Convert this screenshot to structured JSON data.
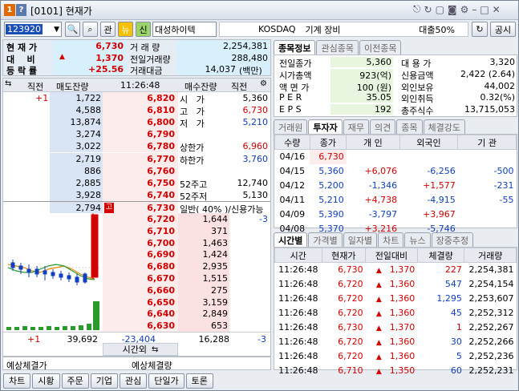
{
  "window": {
    "screen_no": "1",
    "screen_mark": "?",
    "title": "[0101] 현재가",
    "controls": [
      "pin",
      "refresh",
      "capture",
      "camera",
      "settings",
      "minimize",
      "maximize",
      "close"
    ]
  },
  "toolbar": {
    "code": "123920",
    "btn_related": "관",
    "btn_fav": "뉴",
    "btn_credit": "신",
    "name": "대성하이텍",
    "market": "KOSDAQ",
    "sector": "기계 장비",
    "margin": "대출50%",
    "btn_notice": "공시"
  },
  "summary": {
    "rows": [
      {
        "label": "현 재 가",
        "value": "6,730",
        "label2": "거 래 량",
        "value2": "2,254,381"
      },
      {
        "label": "대    비",
        "arrow": "▲",
        "value": "1,370",
        "label2": "전일거래량",
        "value2": "288,480"
      },
      {
        "label": "등 락 률",
        "value": "+25.56",
        "label2": "거래대금",
        "value2": "14,037",
        "unit": "(백만)"
      }
    ]
  },
  "orderbook": {
    "header": {
      "left": "직전",
      "sell_rem": "매도잔량",
      "time": "11:26:48",
      "buy_rem": "매수잔량",
      "right": "직전"
    },
    "asks": [
      {
        "delta": "+1",
        "qty": "1,722",
        "price": "6,820",
        "info_l": "시   가",
        "info_r": "5,360"
      },
      {
        "delta": "",
        "qty": "4,588",
        "price": "6,810",
        "info_l": "고   가",
        "info_r": "6,730"
      },
      {
        "delta": "",
        "qty": "13,874",
        "price": "6,800",
        "info_l": "저   가",
        "info_r": "5,210"
      },
      {
        "delta": "",
        "qty": "3,274",
        "price": "6,790",
        "info_l": "",
        "info_r": ""
      },
      {
        "delta": "",
        "qty": "3,022",
        "price": "6,780",
        "info_l": "상한가",
        "info_r": "6,960"
      },
      {
        "delta": "",
        "qty": "2,719",
        "price": "6,770",
        "info_l": "하한가",
        "info_r": "3,760"
      },
      {
        "delta": "",
        "qty": "886",
        "price": "6,760",
        "info_l": "",
        "info_r": ""
      },
      {
        "delta": "",
        "qty": "2,885",
        "price": "6,750",
        "info_l": "52주고",
        "info_r": "12,740"
      },
      {
        "delta": "",
        "qty": "3,928",
        "price": "6,740",
        "info_l": "52주저",
        "info_r": "5,130"
      },
      {
        "delta": "",
        "qty": "2,794",
        "price": "6,730",
        "high_mark": "고",
        "info_l": "일반( 40% )/신용가능",
        "info_r": ""
      }
    ],
    "bids": [
      {
        "price": "6,720",
        "qty": "1,644",
        "delta": "-3"
      },
      {
        "price": "6,710",
        "qty": "371",
        "delta": ""
      },
      {
        "price": "6,700",
        "qty": "1,463",
        "delta": ""
      },
      {
        "price": "6,690",
        "qty": "1,424",
        "delta": ""
      },
      {
        "price": "6,680",
        "qty": "2,935",
        "delta": ""
      },
      {
        "price": "6,670",
        "qty": "1,515",
        "delta": ""
      },
      {
        "price": "6,660",
        "qty": "275",
        "delta": ""
      },
      {
        "price": "6,650",
        "qty": "3,159",
        "delta": ""
      },
      {
        "price": "6,640",
        "qty": "2,849",
        "delta": ""
      },
      {
        "price": "6,630",
        "qty": "653",
        "delta": ""
      }
    ],
    "footer": {
      "sell_delta": "+1",
      "sell_total": "39,692",
      "net": "-23,404",
      "buy_total": "16,288",
      "buy_delta": "-3",
      "after_hours": "시간외"
    },
    "expect_left": "예상체결가",
    "expect_right": "예상체결량"
  },
  "info": {
    "tabs": [
      "종목정보",
      "관심종목",
      "이전종목"
    ],
    "rows": [
      {
        "l1": "전일종가",
        "v1": "5,360",
        "l2": "대 용 가",
        "v2": "3,320"
      },
      {
        "l1": "시가총액",
        "v1": "923(억)",
        "l2": "신용금액",
        "v2": "2,422  (2.64)"
      },
      {
        "l1": "액 면 가",
        "v1": "100 (원)",
        "l2": "외인보유",
        "v2": "44,002"
      },
      {
        "l1": "P E R",
        "v1": "35.05",
        "l2": "외인취득",
        "v2": "0.32(%)"
      },
      {
        "l1": "E P S",
        "v1": "192",
        "l2": "총주식수",
        "v2": "13,715,053"
      }
    ]
  },
  "investor": {
    "tabs": [
      "거래원",
      "투자자",
      "재무",
      "의견",
      "종목",
      "체결강도"
    ],
    "headers": [
      "수량",
      "종가",
      "개 인",
      "외국인",
      "기 관"
    ],
    "rows": [
      {
        "date": "04/16",
        "close": "6,730",
        "ind": "",
        "for": "",
        "inst": ""
      },
      {
        "date": "04/15",
        "close": "5,360",
        "ind": "+6,076",
        "for": "-6,256",
        "inst": "-500"
      },
      {
        "date": "04/12",
        "close": "5,200",
        "ind": "-1,346",
        "for": "+1,577",
        "inst": "-231"
      },
      {
        "date": "04/11",
        "close": "5,210",
        "ind": "+4,738",
        "for": "-4,915",
        "inst": "-55"
      },
      {
        "date": "04/09",
        "close": "5,390",
        "ind": "-3,797",
        "for": "+3,967",
        "inst": ""
      },
      {
        "date": "04/08",
        "close": "5,370",
        "ind": "+3,216",
        "for": "-5,746",
        "inst": ""
      }
    ]
  },
  "ticks": {
    "tabs": [
      "시간별",
      "가격별",
      "일자별",
      "차트",
      "뉴스",
      "장중추정"
    ],
    "headers": [
      "시간",
      "현재가",
      "전일대비",
      "체결량",
      "거래량"
    ],
    "rows": [
      {
        "time": "11:26:48",
        "price": "6,730",
        "chg": "1,370",
        "vol": "227",
        "cum": "2,254,381",
        "vc": "red"
      },
      {
        "time": "11:26:48",
        "price": "6,720",
        "chg": "1,360",
        "vol": "547",
        "cum": "2,254,154",
        "vc": "blue"
      },
      {
        "time": "11:26:48",
        "price": "6,720",
        "chg": "1,360",
        "vol": "1,295",
        "cum": "2,253,607",
        "vc": "blue"
      },
      {
        "time": "11:26:48",
        "price": "6,720",
        "chg": "1,360",
        "vol": "45",
        "cum": "2,252,312",
        "vc": "blue"
      },
      {
        "time": "11:26:48",
        "price": "6,730",
        "chg": "1,370",
        "vol": "1",
        "cum": "2,252,267",
        "vc": "red"
      },
      {
        "time": "11:26:48",
        "price": "6,720",
        "chg": "1,360",
        "vol": "30",
        "cum": "2,252,266",
        "vc": "blue"
      },
      {
        "time": "11:26:48",
        "price": "6,720",
        "chg": "1,360",
        "vol": "5",
        "cum": "2,252,236",
        "vc": "blue"
      },
      {
        "time": "11:26:48",
        "price": "6,710",
        "chg": "1,350",
        "vol": "60",
        "cum": "2,252,231",
        "vc": "blue"
      }
    ]
  },
  "bottom": [
    "차트",
    "시황",
    "주문",
    "기업",
    "관심",
    "단일가",
    "토론"
  ],
  "colors": {
    "up": "#d40000",
    "down": "#1040c0",
    "ask_bg": "#d9e5f5",
    "bid_bg": "#fbe1e1",
    "title_bar": "#dfe6f0",
    "panel_bg": "#ffffff",
    "sum_bg": "#d8f0fb"
  }
}
